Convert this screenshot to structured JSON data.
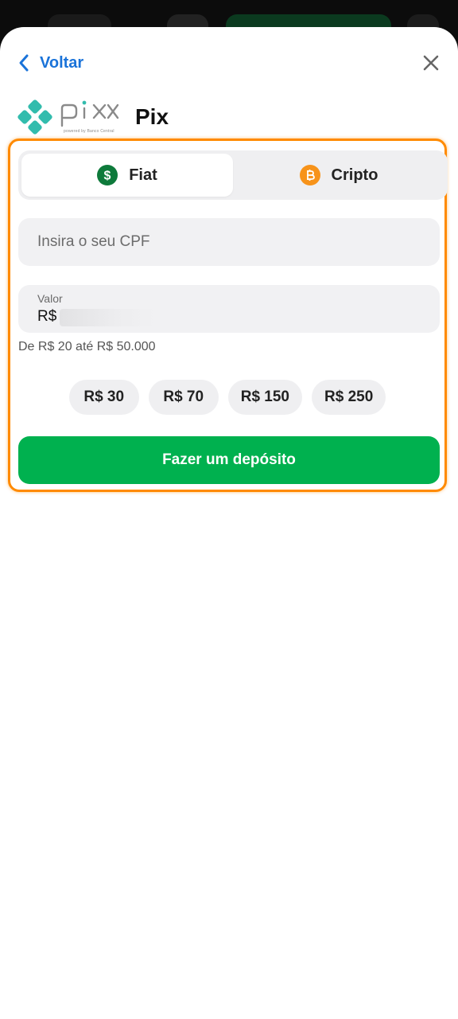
{
  "header": {
    "back_label": "Voltar",
    "title": "Pix"
  },
  "pix_logo": {
    "subtext": "powered by Banco Central"
  },
  "tabs": [
    {
      "label": "Fiat",
      "icon": "dollar-coin-icon",
      "active": true
    },
    {
      "label": "Cripto",
      "icon": "bitcoin-icon",
      "active": false
    }
  ],
  "cpf_input": {
    "placeholder": "Insira o seu CPF",
    "value": ""
  },
  "amount_input": {
    "label": "Valor",
    "currency": "R$"
  },
  "range_hint": "De R$ 20 até R$ 50.000",
  "quick_amounts": [
    "R$ 30",
    "R$ 70",
    "R$ 150",
    "R$ 250"
  ],
  "cta_label": "Fazer um depósito",
  "colors": {
    "accent": "#1a73d9",
    "cta": "#00b14f",
    "highlight": "#ff8a00",
    "fiat_coin": "#0e7a3b",
    "crypto_coin": "#f7931a",
    "pix_teal": "#32bcad"
  }
}
